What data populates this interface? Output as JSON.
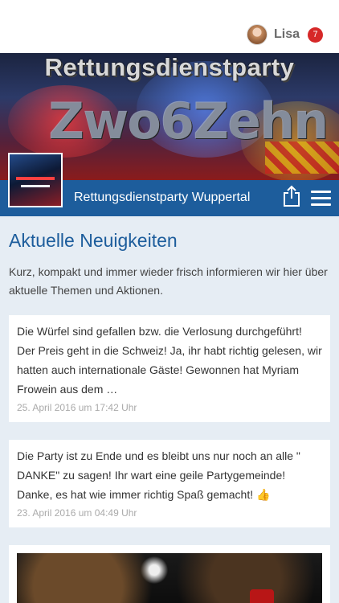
{
  "user": {
    "name": "Lisa",
    "notifications": "7"
  },
  "hero": {
    "title": "Rettungsdienstparty",
    "logo_text": "Zwo6Zehn"
  },
  "app": {
    "title": "Rettungsdienstparty Wuppertal"
  },
  "section": {
    "title": "Aktuelle Neuigkeiten",
    "description": "Kurz, kompakt und immer wieder frisch informieren wir hier über aktuelle Themen und Aktionen."
  },
  "posts": [
    {
      "text": "Die Würfel sind gefallen bzw. die Verlosung durchgeführt! Der Preis geht in die Schweiz! Ja, ihr habt richtig gelesen, wir hatten auch internationale Gäste! Gewonnen hat Myriam Frowein aus dem …",
      "date": "25. April 2016 um 17:42 Uhr"
    },
    {
      "text": "Die Party ist zu Ende und es bleibt uns nur noch an alle \" DANKE\" zu sagen! Ihr wart eine geile Partygemeinde! Danke, es hat wie immer richtig Spaß gemacht!",
      "emoji": "👍",
      "date": "23. April 2016 um 04:49 Uhr"
    }
  ],
  "colors": {
    "primary": "#1d5d9c",
    "background": "#e6edf4",
    "badge": "#d62828"
  },
  "icons": [
    "share-icon",
    "hamburger-menu-icon"
  ]
}
